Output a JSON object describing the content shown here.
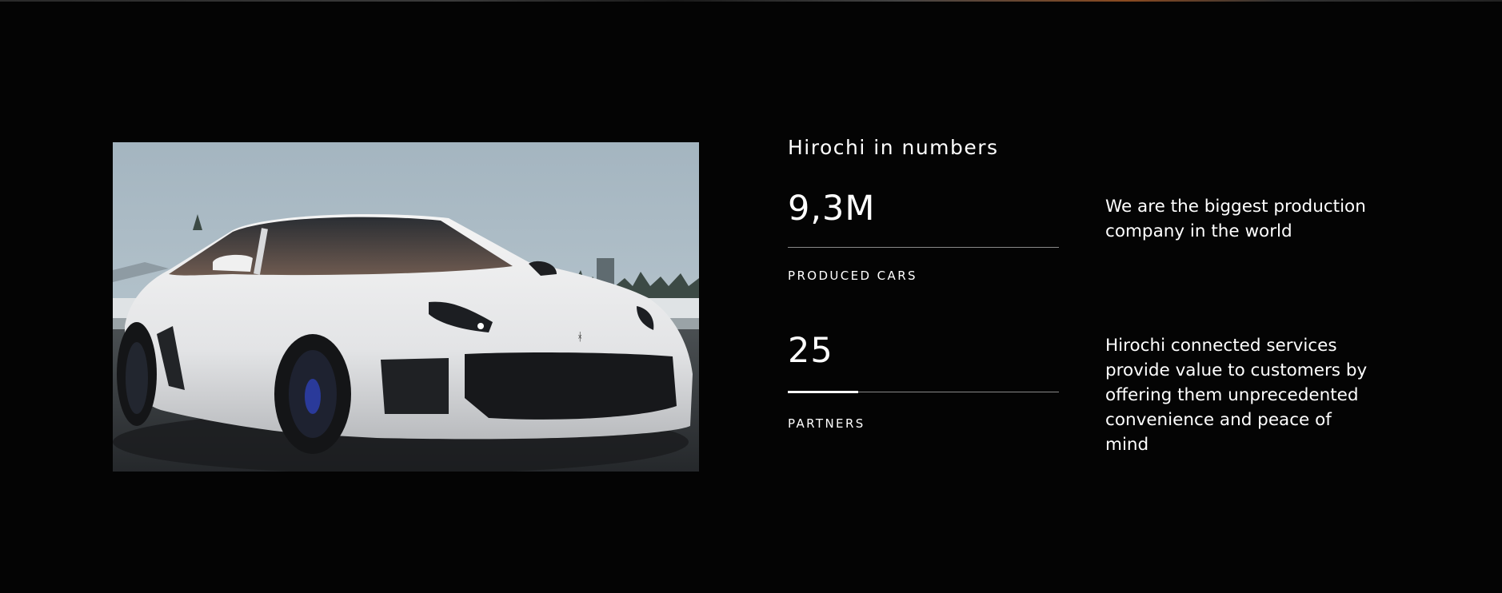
{
  "section": {
    "title": "Hirochi in numbers"
  },
  "photo": {
    "subject": "white sports coupe on a race track"
  },
  "stats": [
    {
      "value": "9,3M",
      "label": "PRODUCED CARS",
      "progress": 0.0,
      "description": "We are the biggest production company in the world"
    },
    {
      "value": "25",
      "label": "PARTNERS",
      "progress": 0.26,
      "description": "Hirochi connected services provide value to customers by offering them unprecedented convenience and peace of mind"
    }
  ],
  "colors": {
    "background": "#040404",
    "text": "#ffffff",
    "track": "#8a8a8a",
    "fill": "#ffffff"
  }
}
